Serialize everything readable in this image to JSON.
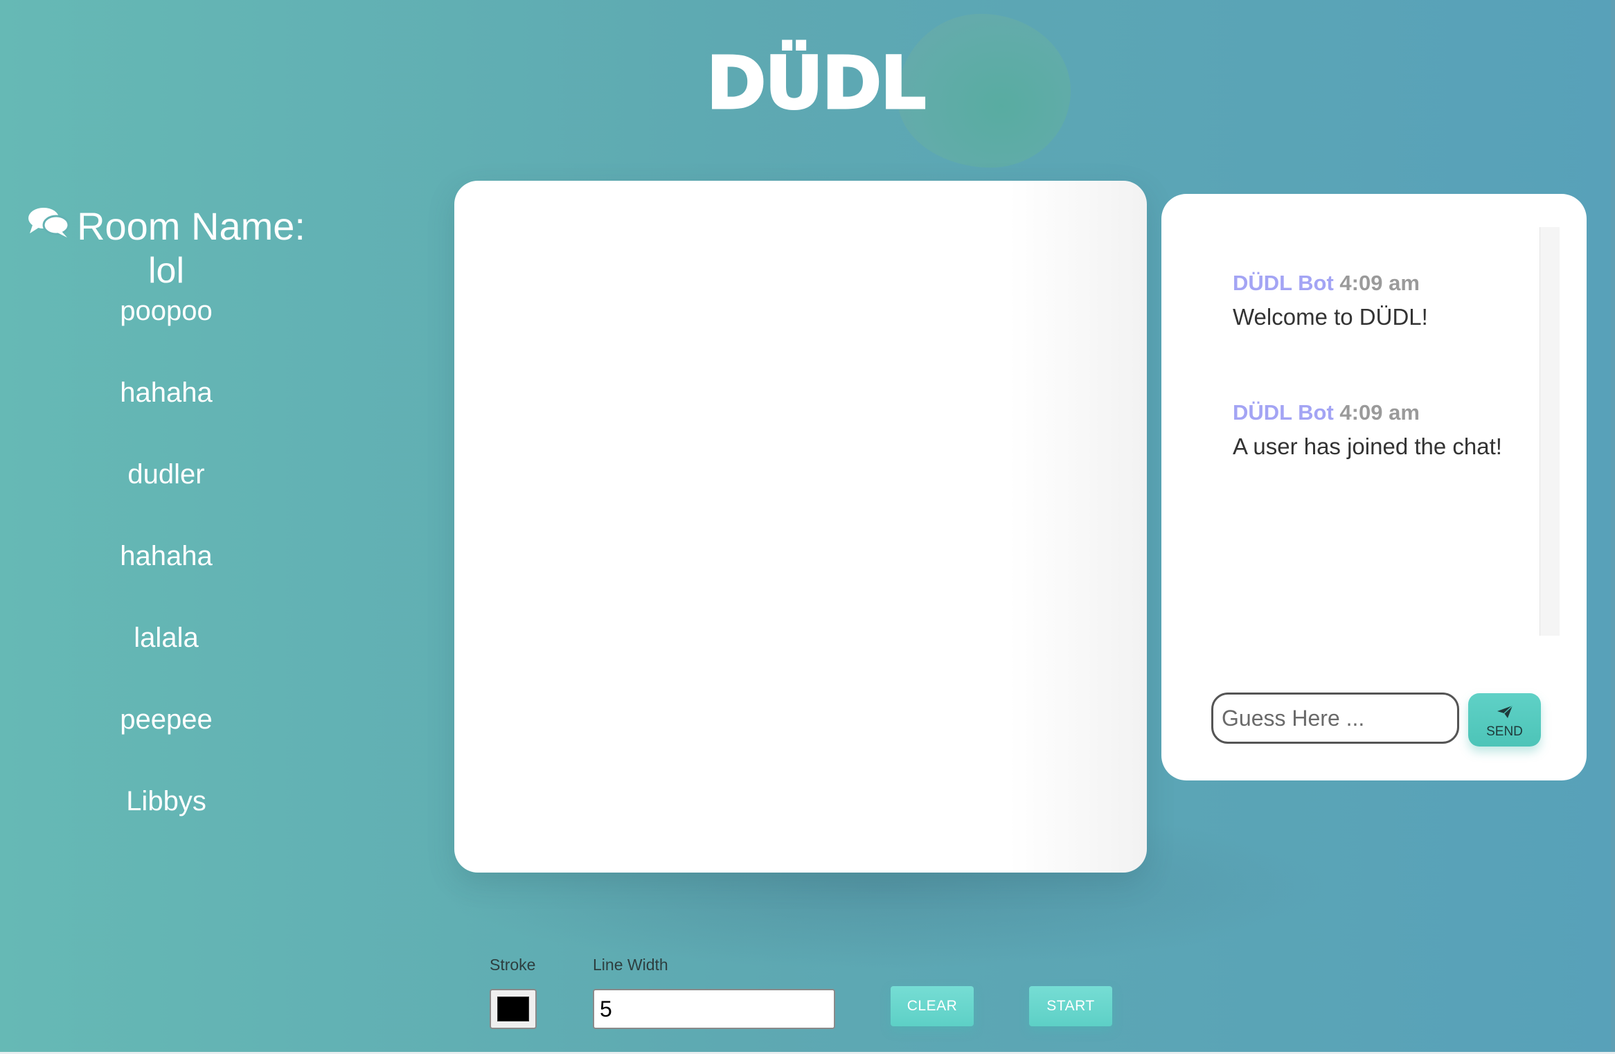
{
  "app": {
    "logo": "DÜDL"
  },
  "sidebar": {
    "room_label": "Room Name:",
    "room_name": "lol",
    "players": [
      "poopoo",
      "hahaha",
      "dudler",
      "hahaha",
      "lalala",
      "peepee",
      "Libbys"
    ]
  },
  "chat": {
    "messages": [
      {
        "user": "DÜDL Bot",
        "time": "4:09 am",
        "text": "Welcome to DÜDL!"
      },
      {
        "user": "DÜDL Bot",
        "time": "4:09 am",
        "text": "A user has joined the chat!"
      }
    ],
    "input_placeholder": "Guess Here ...",
    "send_label": "SEND"
  },
  "controls": {
    "stroke_label": "Stroke",
    "stroke_color": "#000000",
    "line_width_label": "Line Width",
    "line_width_value": "5",
    "clear_label": "CLEAR",
    "start_label": "START"
  },
  "colors": {
    "accent": "#5dd0c6",
    "bot_name": "#a3a4f4",
    "background": "#5ea9b2"
  },
  "icons": {
    "room": "comments-icon",
    "send": "paper-plane-icon"
  }
}
